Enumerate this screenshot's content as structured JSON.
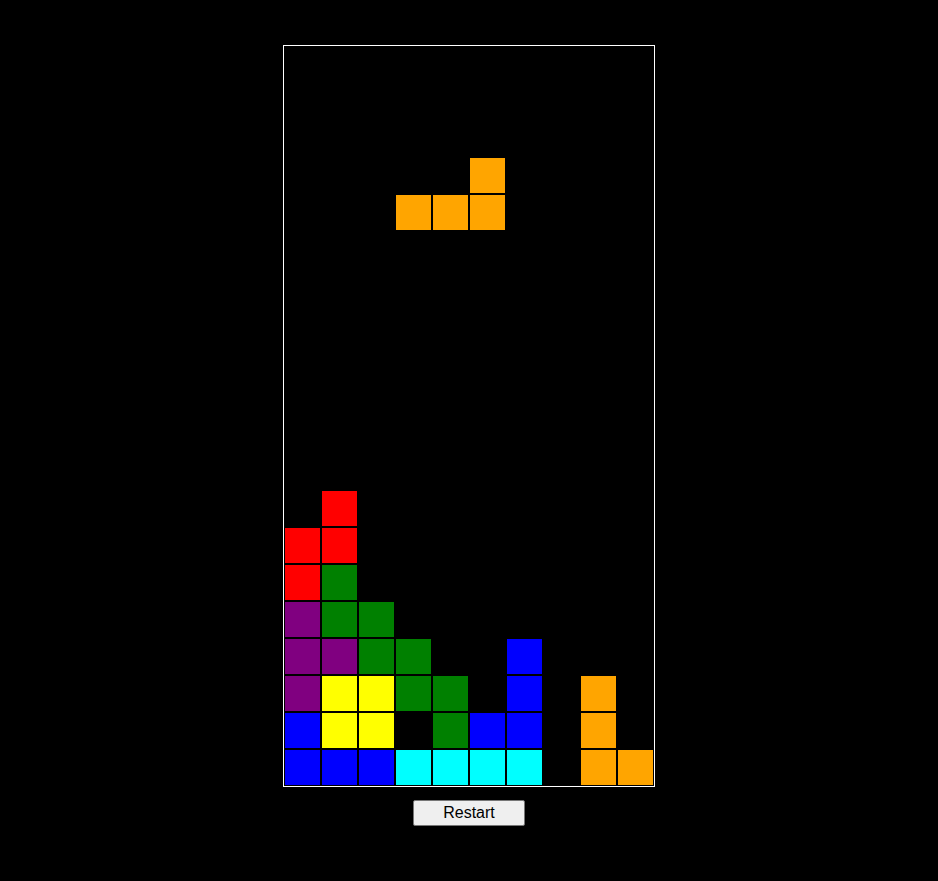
{
  "board": {
    "rows": [
      [
        null,
        null,
        null,
        null,
        null,
        null,
        null,
        null,
        null,
        null
      ],
      [
        null,
        null,
        null,
        null,
        null,
        null,
        null,
        null,
        null,
        null
      ],
      [
        null,
        null,
        null,
        null,
        null,
        null,
        null,
        null,
        null,
        null
      ],
      [
        null,
        null,
        null,
        null,
        null,
        "#ffa500",
        null,
        null,
        null,
        null
      ],
      [
        null,
        null,
        null,
        "#ffa500",
        "#ffa500",
        "#ffa500",
        null,
        null,
        null,
        null
      ],
      [
        null,
        null,
        null,
        null,
        null,
        null,
        null,
        null,
        null,
        null
      ],
      [
        null,
        null,
        null,
        null,
        null,
        null,
        null,
        null,
        null,
        null
      ],
      [
        null,
        null,
        null,
        null,
        null,
        null,
        null,
        null,
        null,
        null
      ],
      [
        null,
        null,
        null,
        null,
        null,
        null,
        null,
        null,
        null,
        null
      ],
      [
        null,
        null,
        null,
        null,
        null,
        null,
        null,
        null,
        null,
        null
      ],
      [
        null,
        null,
        null,
        null,
        null,
        null,
        null,
        null,
        null,
        null
      ],
      [
        null,
        null,
        null,
        null,
        null,
        null,
        null,
        null,
        null,
        null
      ],
      [
        null,
        "#ff0000",
        null,
        null,
        null,
        null,
        null,
        null,
        null,
        null
      ],
      [
        "#ff0000",
        "#ff0000",
        null,
        null,
        null,
        null,
        null,
        null,
        null,
        null
      ],
      [
        "#ff0000",
        "#008000",
        null,
        null,
        null,
        null,
        null,
        null,
        null,
        null
      ],
      [
        "#800080",
        "#008000",
        "#008000",
        null,
        null,
        null,
        null,
        null,
        null,
        null
      ],
      [
        "#800080",
        "#800080",
        "#008000",
        "#008000",
        null,
        null,
        "#0000ff",
        null,
        null,
        null
      ],
      [
        "#800080",
        "#ffff00",
        "#ffff00",
        "#008000",
        "#008000",
        null,
        "#0000ff",
        null,
        "#ffa500",
        null
      ],
      [
        "#0000ff",
        "#ffff00",
        "#ffff00",
        null,
        "#008000",
        "#0000ff",
        "#0000ff",
        null,
        "#ffa500",
        null
      ],
      [
        "#0000ff",
        "#0000ff",
        "#0000ff",
        "#00ffff",
        "#00ffff",
        "#00ffff",
        "#00ffff",
        null,
        "#ffa500",
        "#ffa500"
      ]
    ]
  },
  "button": "Restart"
}
